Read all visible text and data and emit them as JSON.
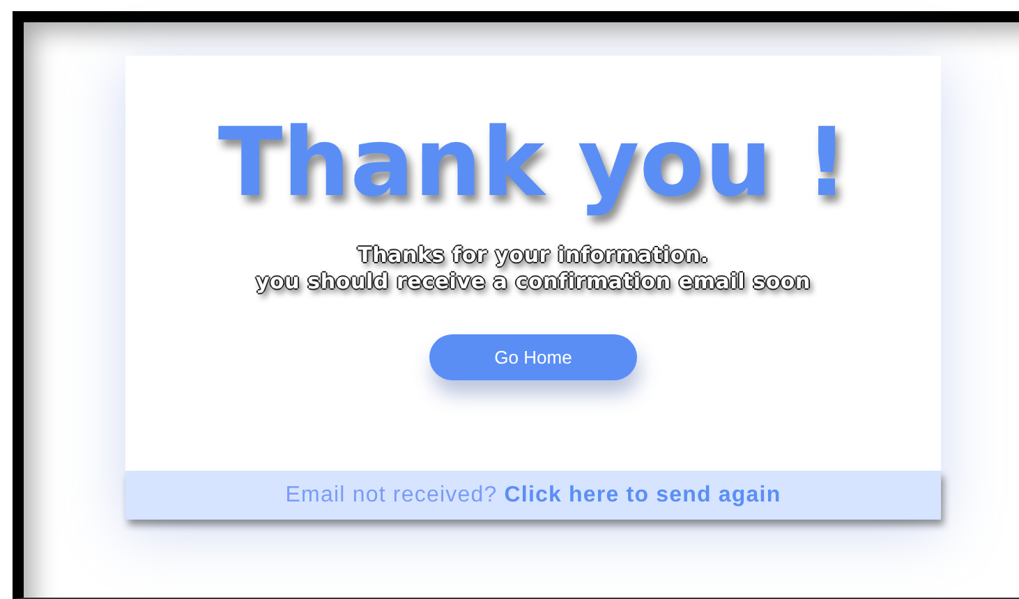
{
  "heading": "Thank you !",
  "message": [
    "Thanks for your information.",
    "you should receive a confirmation email soon"
  ],
  "button": "Go Home",
  "footer": {
    "text": "Email not received?",
    "link": "Click here to send again"
  }
}
